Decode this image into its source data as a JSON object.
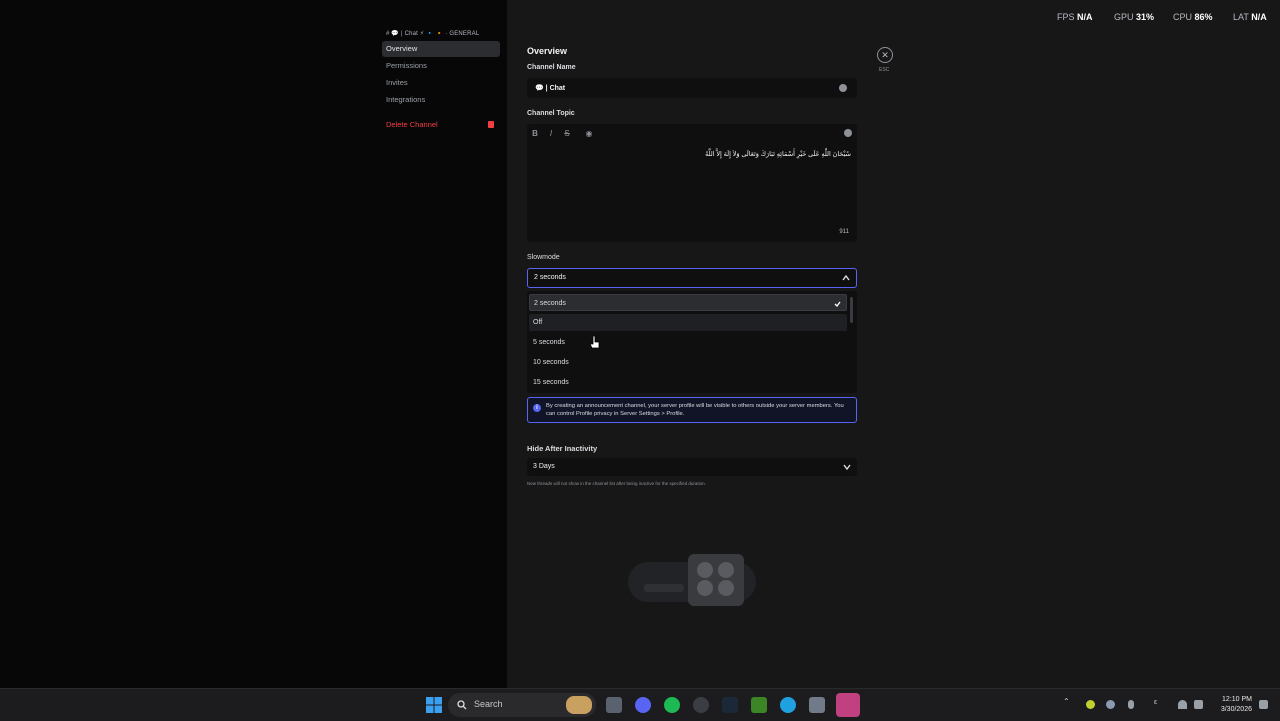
{
  "sidebar": {
    "header": "# 💬 | Chat ⚡ 🔹 🔸 · GENERAL",
    "items": [
      {
        "label": "Overview"
      },
      {
        "label": "Permissions"
      },
      {
        "label": "Invites"
      },
      {
        "label": "Integrations"
      }
    ],
    "delete_label": "Delete Channel"
  },
  "main": {
    "title": "Overview",
    "close_label": "ESC",
    "channel_name": {
      "label": "Channel Name",
      "value": "💬 | Chat"
    },
    "channel_topic": {
      "label": "Channel Topic",
      "toolbar": [
        "B",
        "I",
        "S"
      ],
      "value": "سُبْحَانَ اللَّهِ عَلَى خَيْرِ أَسْمَائِهِ تَبَارَكَ وَتَعَالَى وَلاَ إِلَهَ إِلاَّ اللَّهُ",
      "char_count": "911"
    },
    "slowmode": {
      "label": "Slowmode",
      "selected": "2 seconds",
      "options": [
        "2 seconds",
        "Off",
        "5 seconds",
        "10 seconds",
        "15 seconds"
      ]
    },
    "info": "By creating an announcement channel, your server profile will be visible to others outside your server members. You can control Profile privacy in Server Settings > Profile.",
    "hide_after": {
      "label": "Hide After Inactivity",
      "value": "3 Days",
      "hint": "New threads will not show in the channel list after being inactive for the specified duration."
    }
  },
  "overlay": {
    "fps_label": "FPS",
    "fps_value": "N/A",
    "gpu_label": "GPU",
    "gpu_value": "31%",
    "cpu_label": "CPU",
    "cpu_value": "86%",
    "lat_label": "LAT",
    "lat_value": "N/A"
  },
  "taskbar": {
    "search_label": "Search",
    "time": "12:10 PM",
    "date": "3/30/2026"
  },
  "colors": {
    "accent": "#5865f2",
    "danger": "#f23f42"
  }
}
